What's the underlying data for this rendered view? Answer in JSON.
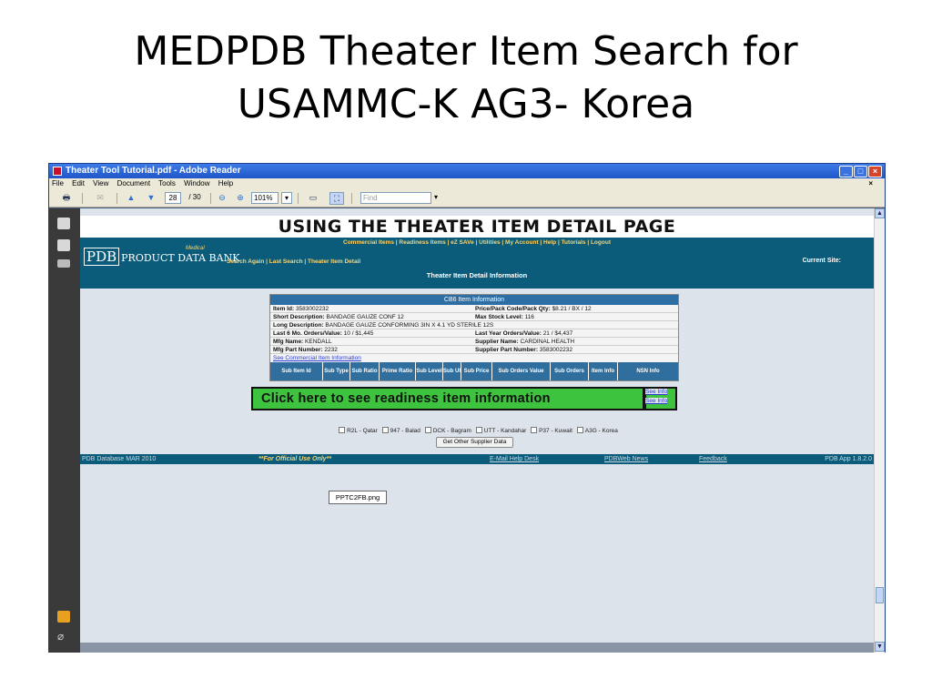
{
  "slide": {
    "title_line1": "MEDPDB Theater Item Search for",
    "title_line2": "USAMMC-K AG3- Korea"
  },
  "window": {
    "title": "Theater Tool Tutorial.pdf - Adobe Reader",
    "min_label": "_",
    "max_label": "□",
    "close_label": "×"
  },
  "menu": {
    "file": "File",
    "edit": "Edit",
    "view": "View",
    "document": "Document",
    "tools": "Tools",
    "window": "Window",
    "help": "Help",
    "close_doc": "×"
  },
  "toolbar": {
    "page_current": "28",
    "page_sep": "/ 30",
    "zoom": "101%",
    "find_placeholder": "Find"
  },
  "page": {
    "banner": "USING THE THEATER ITEM DETAIL PAGE",
    "nav_links": "Commercial Items | Readiness Items | eZ SAVe | Utilities | My Account | Help | Tutorials | Logout",
    "logo_pdb": "PDB",
    "logo_name": "PRODUCT DATA BANK",
    "logo_medical": "Medical",
    "sub_links": "Search Again | Last Search | Theater Item Detail",
    "current_site": "Current Site:",
    "section_title": "Theater Item Detail Information"
  },
  "item": {
    "header": "CB6 Item Information",
    "rows": [
      {
        "l1": "Item Id:",
        "v1": "3583002232",
        "l2": "Price/Pack Code/Pack Qty:",
        "v2": "$8.21 / BX / 12"
      },
      {
        "l1": "Short Description:",
        "v1": "BANDAGE GAUZE CONF 12",
        "l2": "Max Stock Level:",
        "v2": "116"
      },
      {
        "l1": "Long Description:",
        "v1": "BANDAGE GAUZE CONFORMING 3IN X 4.1 YD STERILE 12S",
        "l2": "",
        "v2": ""
      },
      {
        "l1": "Last 6 Mo. Orders/Value:",
        "v1": "10 / $1,445",
        "l2": "Last Year Orders/Value:",
        "v2": "21 / $4,437"
      },
      {
        "l1": "Mfg Name:",
        "v1": "KENDALL",
        "l2": "Supplier Name:",
        "v2": "CARDINAL HEALTH"
      },
      {
        "l1": "Mfg Part Number:",
        "v1": "2232",
        "l2": "Supplier Part Number:",
        "v2": "3583002232"
      }
    ],
    "commercial_link": "See Commercial Item Information",
    "columns": [
      "Sub Item Id",
      "Sub Type",
      "Sub Ratio",
      "Prime Ratio",
      "Sub Level",
      "Sub UI",
      "Sub Price",
      "Sub Orders Value",
      "Sub Orders",
      "Item Info",
      "NSN Info"
    ]
  },
  "callout": {
    "text": "Click here to see readiness item information",
    "see_info_1": "See Info",
    "see_info_2": "See Info"
  },
  "sites": {
    "s1": "R2L - Qatar",
    "s2": "947 - Balad",
    "s3": "DCK - Bagram",
    "s4": "UTT - Kandahar",
    "s5": "P37 - Kuwait",
    "s6": "A3G - Korea",
    "button": "Get Other Supplier Data"
  },
  "footer": {
    "db": "PDB Database MAR 2010",
    "official": "**For Official Use Only**",
    "help": "E-Mail Help Desk",
    "news": "PDBWeb News",
    "feedback": "Feedback",
    "version": "PDB App 1.8.2.0"
  },
  "image_label": "PPTC2FB.png"
}
